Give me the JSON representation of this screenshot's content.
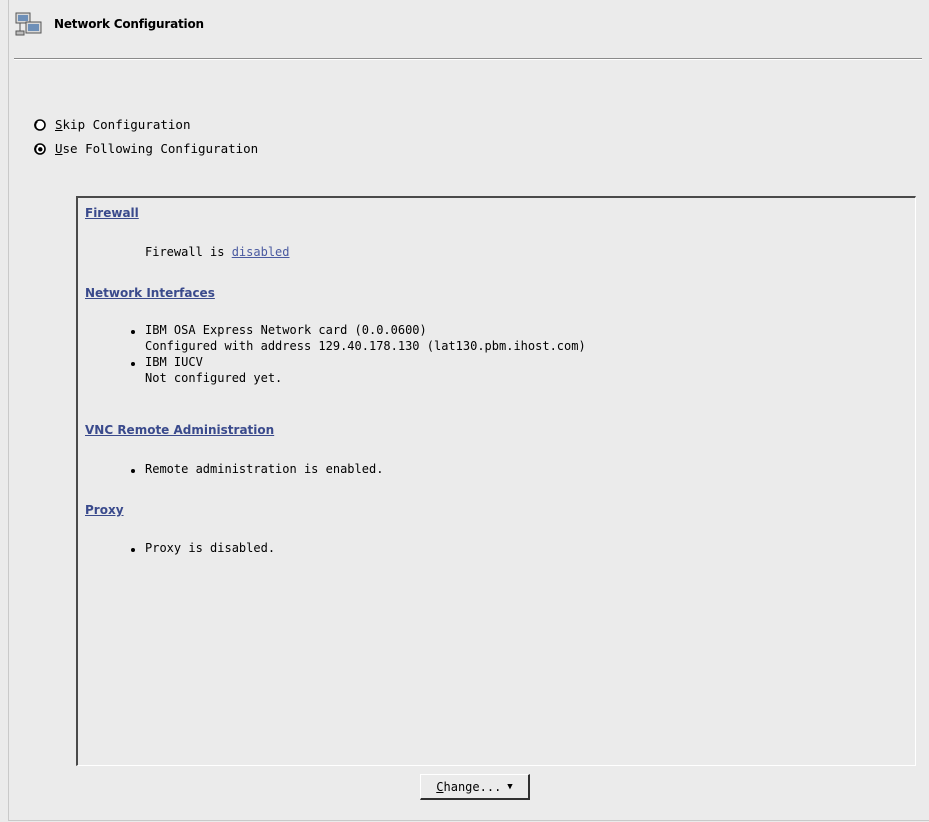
{
  "header": {
    "title": "Network Configuration",
    "icon": "network-config-icon"
  },
  "options": [
    {
      "label": "Skip Configuration",
      "mnemonic": "S",
      "rest": "kip Configuration",
      "selected": false
    },
    {
      "label": "Use Following Configuration",
      "mnemonic": "U",
      "rest": "se Following Configuration",
      "selected": true
    }
  ],
  "summary": {
    "firewall": {
      "heading": "Firewall",
      "text_prefix": "Firewall is ",
      "status_link": "disabled"
    },
    "network_interfaces": {
      "heading": "Network Interfaces",
      "items": [
        {
          "title": "IBM OSA Express Network card (0.0.0600)",
          "detail": "Configured with address 129.40.178.130 (lat130.pbm.ihost.com)"
        },
        {
          "title": "IBM IUCV",
          "detail": "Not configured yet."
        }
      ]
    },
    "vnc": {
      "heading": "VNC Remote Administration",
      "items": [
        "Remote administration is enabled."
      ]
    },
    "proxy": {
      "heading": "Proxy",
      "items": [
        "Proxy is disabled."
      ]
    }
  },
  "change_button": {
    "label": "Change...",
    "mnemonic": "C",
    "rest": "hange..."
  },
  "colors": {
    "background": "#ebebeb",
    "link": "#3a4a8c"
  }
}
